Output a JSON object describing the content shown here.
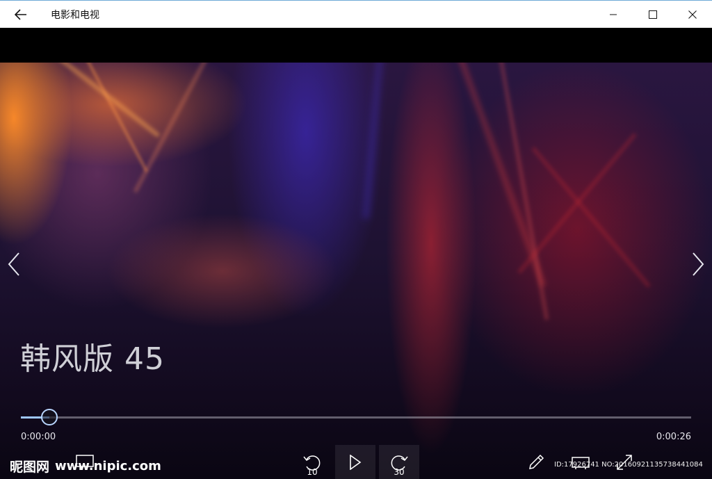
{
  "window": {
    "title": "电影和电视",
    "back_icon": "back-arrow-icon",
    "minimize_icon": "minimize-icon",
    "maximize_icon": "maximize-icon",
    "close_icon": "close-icon"
  },
  "video": {
    "title": "韩风版 45",
    "prev_icon": "chevron-left-icon",
    "next_icon": "chevron-right-icon"
  },
  "playback": {
    "current_time": "0:00:00",
    "total_time": "0:00:26",
    "progress": 0.043
  },
  "controls": {
    "skip_back_value": "10",
    "skip_forward_value": "30",
    "play_icon": "play-icon",
    "edit_icon": "pencil-icon",
    "fullscreen_icon": "expand-icon"
  },
  "watermark": {
    "logo": "昵图网",
    "url": "www.nipic.com",
    "id_text": "ID:17926741 NO:20160921135738441084"
  },
  "colors": {
    "accent": "#9ec7ff",
    "titlebar_bg": "#ffffff"
  }
}
